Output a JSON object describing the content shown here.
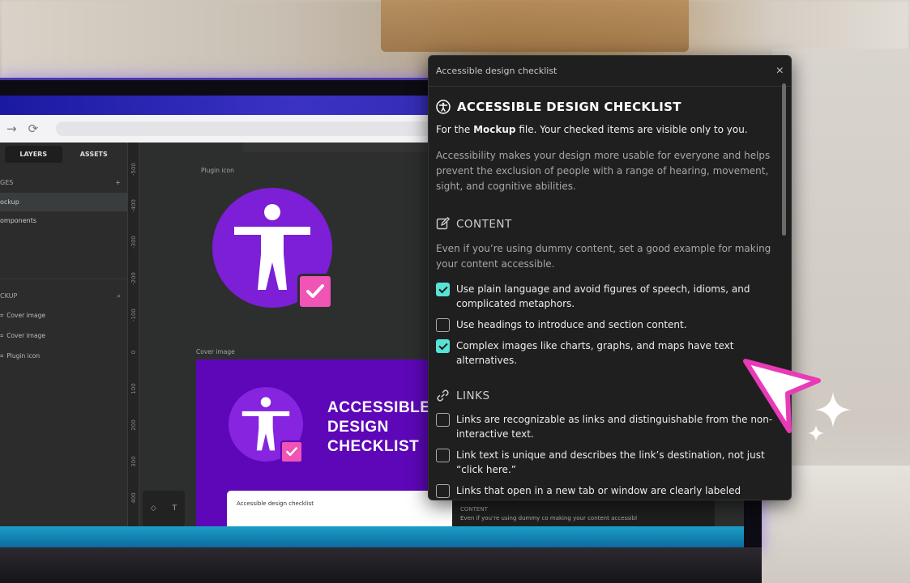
{
  "panel": {
    "header_title": "Accessible design checklist",
    "close_label": "×",
    "title": "ACCESSIBLE DESIGN CHECKLIST",
    "subtitle_prefix": "For the ",
    "subtitle_file": "Mockup",
    "subtitle_suffix": " file. Your checked items are visible only to you.",
    "intro": "Accessibility makes your design more usable for everyone and helps prevent the exclusion of people with a range of hearing, movement, sight, and cognitive abilities.",
    "sections": [
      {
        "title": "CONTENT",
        "icon": "edit-icon",
        "description": "Even if you’re using dummy content, set a good example for making your content accessible.",
        "items": [
          {
            "label": "Use plain language and avoid figures of speech, idioms, and complicated metaphors.",
            "checked": true
          },
          {
            "label": "Use headings to introduce and section content.",
            "checked": false
          },
          {
            "label": "Complex images like charts, graphs, and maps have text alternatives.",
            "checked": true
          }
        ]
      },
      {
        "title": "LINKS",
        "icon": "link-icon",
        "items": [
          {
            "label": "Links are recognizable as links and distinguishable from the non-interactive text.",
            "checked": false
          },
          {
            "label": "Link text is unique and describes the link’s destination, not just “click here.”",
            "checked": false
          },
          {
            "label": "Links that open in a new tab or window are clearly labeled",
            "checked": false
          }
        ]
      }
    ]
  },
  "editor": {
    "tabs": [
      "LAYERS",
      "ASSETS"
    ],
    "pages_label": "GES",
    "pages": [
      "ockup",
      "omponents"
    ],
    "layers_label": "CKUP",
    "layers": [
      "Cover image",
      "Cover image",
      "Plugin icon"
    ],
    "ruler_marks": [
      "-500",
      "-400",
      "-300",
      "-200",
      "-100",
      "0",
      "100",
      "200",
      "300",
      "400"
    ],
    "plugin_icon_label": "Plugin icon",
    "cover_image_label": "Cover image",
    "cover_title": "ACCESSIBLE\nDESIGN\nCHECKLIST",
    "mini_panel_title": "Accessible design checklist",
    "mini_panel2_heading": "CONTENT",
    "mini_panel2_text": "Even if you’re using dummy co making your content accessibl"
  },
  "colors": {
    "accent_check": "#57e3d6",
    "brand_purple": "#7c1fd6",
    "pink": "#f054b4"
  }
}
